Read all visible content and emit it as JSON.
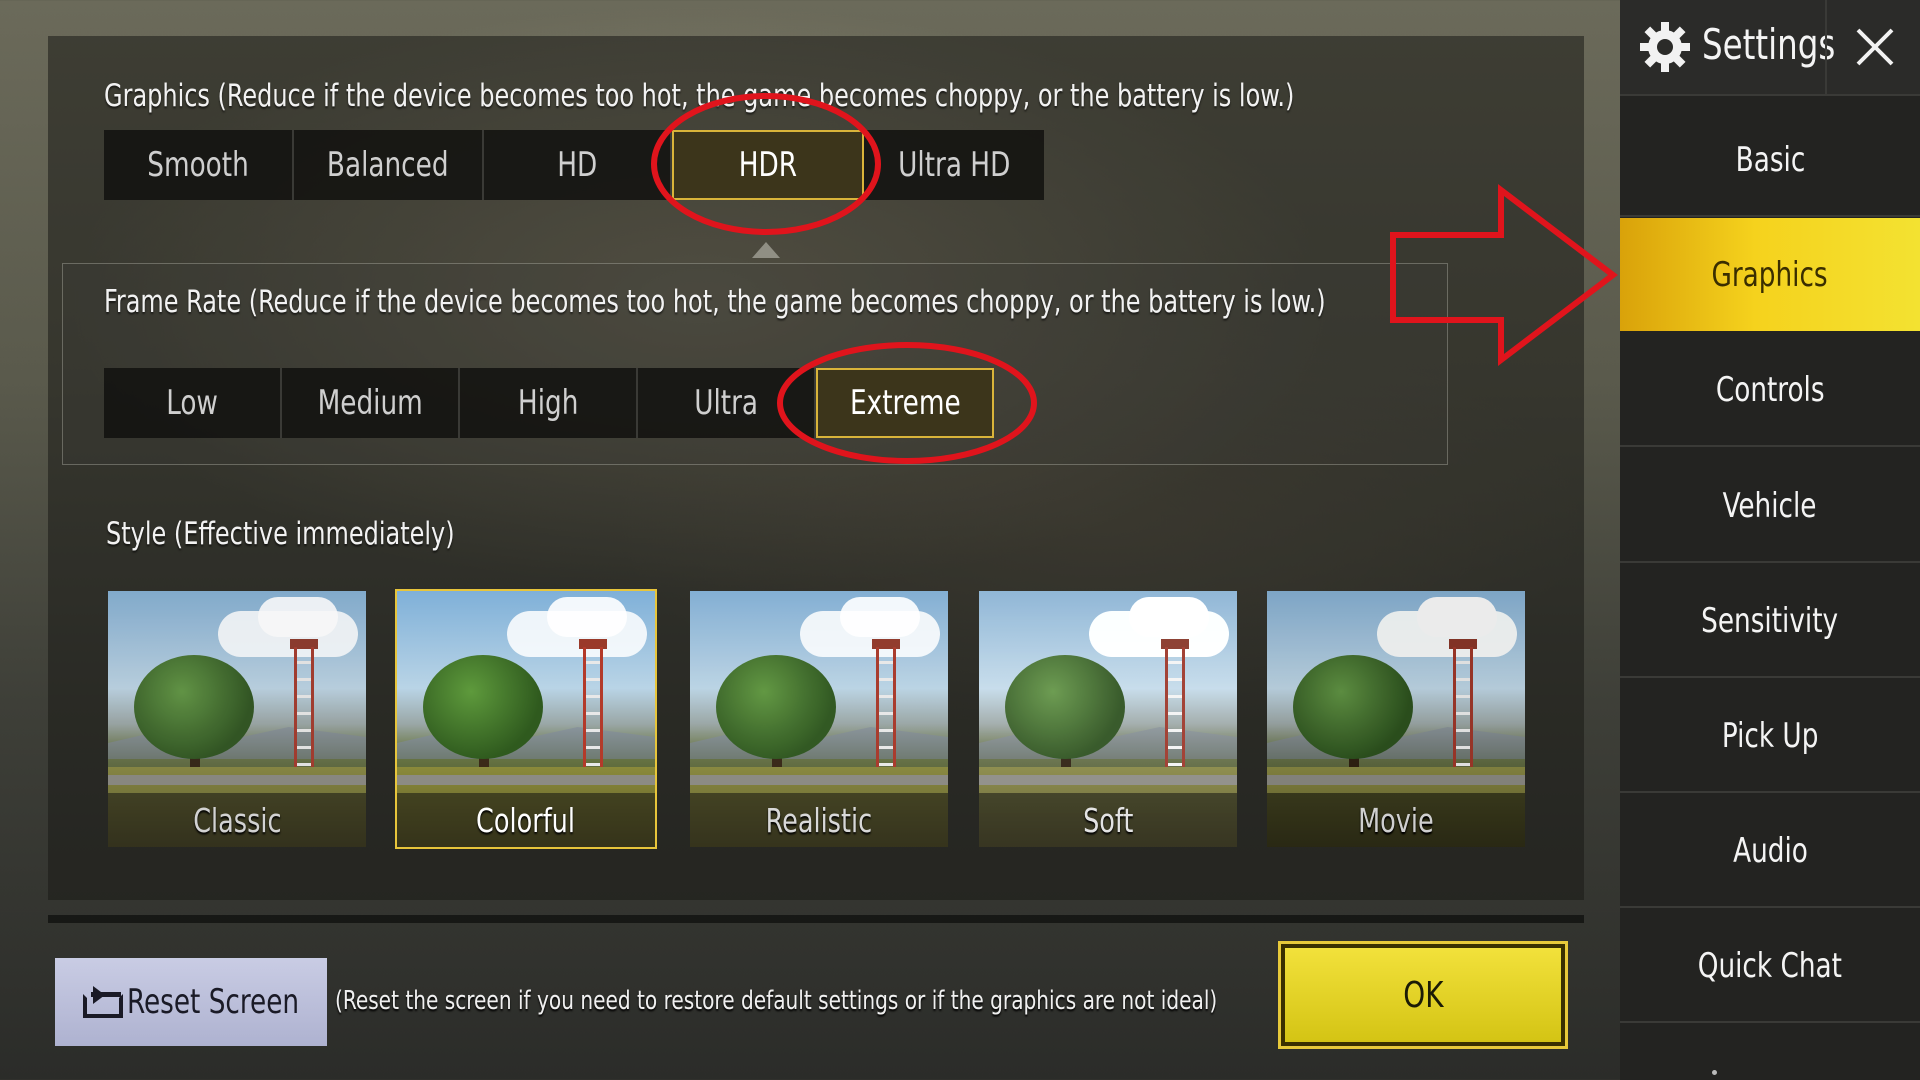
{
  "graphics": {
    "title": "Graphics (Reduce if the device becomes too hot, the game becomes choppy, or the battery is low.)",
    "options": [
      "Smooth",
      "Balanced",
      "HD",
      "HDR",
      "Ultra HD"
    ],
    "selected": "HDR"
  },
  "frame_rate": {
    "title": "Frame Rate (Reduce if the device becomes too hot, the game becomes choppy, or the battery is low.)",
    "options": [
      "Low",
      "Medium",
      "High",
      "Ultra",
      "Extreme"
    ],
    "selected": "Extreme"
  },
  "style": {
    "title": "Style (Effective immediately)",
    "options": [
      "Classic",
      "Colorful",
      "Realistic",
      "Soft",
      "Movie"
    ],
    "selected": "Colorful"
  },
  "reset": {
    "label": "Reset Screen",
    "note": "(Reset the screen if you need to restore default settings or if the graphics are not ideal)"
  },
  "ok_label": "OK",
  "sidebar": {
    "title": "Settings",
    "items": [
      "Basic",
      "Graphics",
      "Controls",
      "Vehicle",
      "Sensitivity",
      "Pick Up",
      "Audio",
      "Quick Chat"
    ],
    "active": "Graphics"
  },
  "colors": {
    "accent_yellow": "#f5d21d",
    "highlight_red": "#e0141c",
    "selected_border": "#d9b43a"
  },
  "icons": [
    "gear-icon",
    "close-icon",
    "reset-screen-icon",
    "red-arrow-annotation",
    "red-ellipse-annotation"
  ]
}
